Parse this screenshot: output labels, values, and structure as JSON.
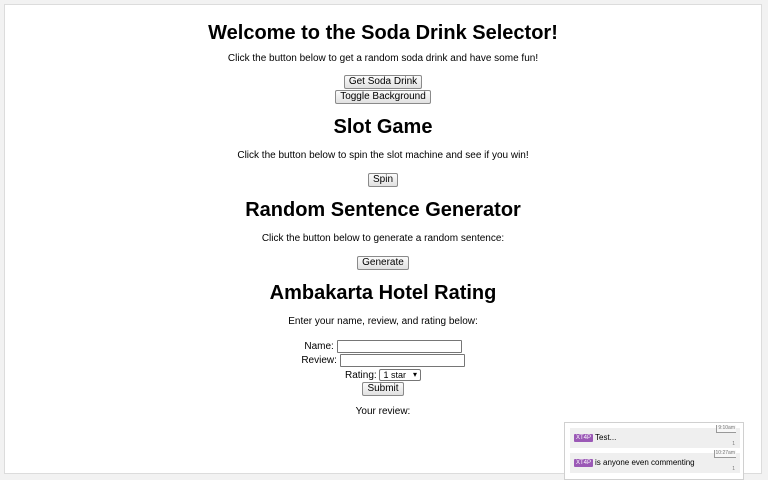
{
  "soda": {
    "title": "Welcome to the Soda Drink Selector!",
    "description": "Click the button below to get a random soda drink and have some fun!",
    "get_button": "Get Soda Drink",
    "toggle_button": "Toggle Background"
  },
  "slot": {
    "title": "Slot Game",
    "description": "Click the button below to spin the slot machine and see if you win!",
    "spin_button": "Spin"
  },
  "sentence": {
    "title": "Random Sentence Generator",
    "description": "Click the button below to generate a random sentence:",
    "generate_button": "Generate"
  },
  "hotel": {
    "title": "Ambakarta Hotel Rating",
    "description": "Enter your name, review, and rating below:",
    "name_label": "Name:",
    "name_value": "",
    "review_label": "Review:",
    "review_value": "",
    "rating_label": "Rating:",
    "rating_selected": "1 star",
    "submit_button": "Submit",
    "your_review_label": "Your review:"
  },
  "chat": {
    "messages": [
      {
        "user_tag": "XT4P",
        "text": "Test...",
        "time": "9:10am",
        "count": "1"
      },
      {
        "user_tag": "XT4P",
        "text": "is anyone even commenting",
        "time": "10:27am",
        "count": "1"
      }
    ]
  },
  "colors": {
    "user_tag": "#9b59b6",
    "page_background": "#ffffff"
  }
}
